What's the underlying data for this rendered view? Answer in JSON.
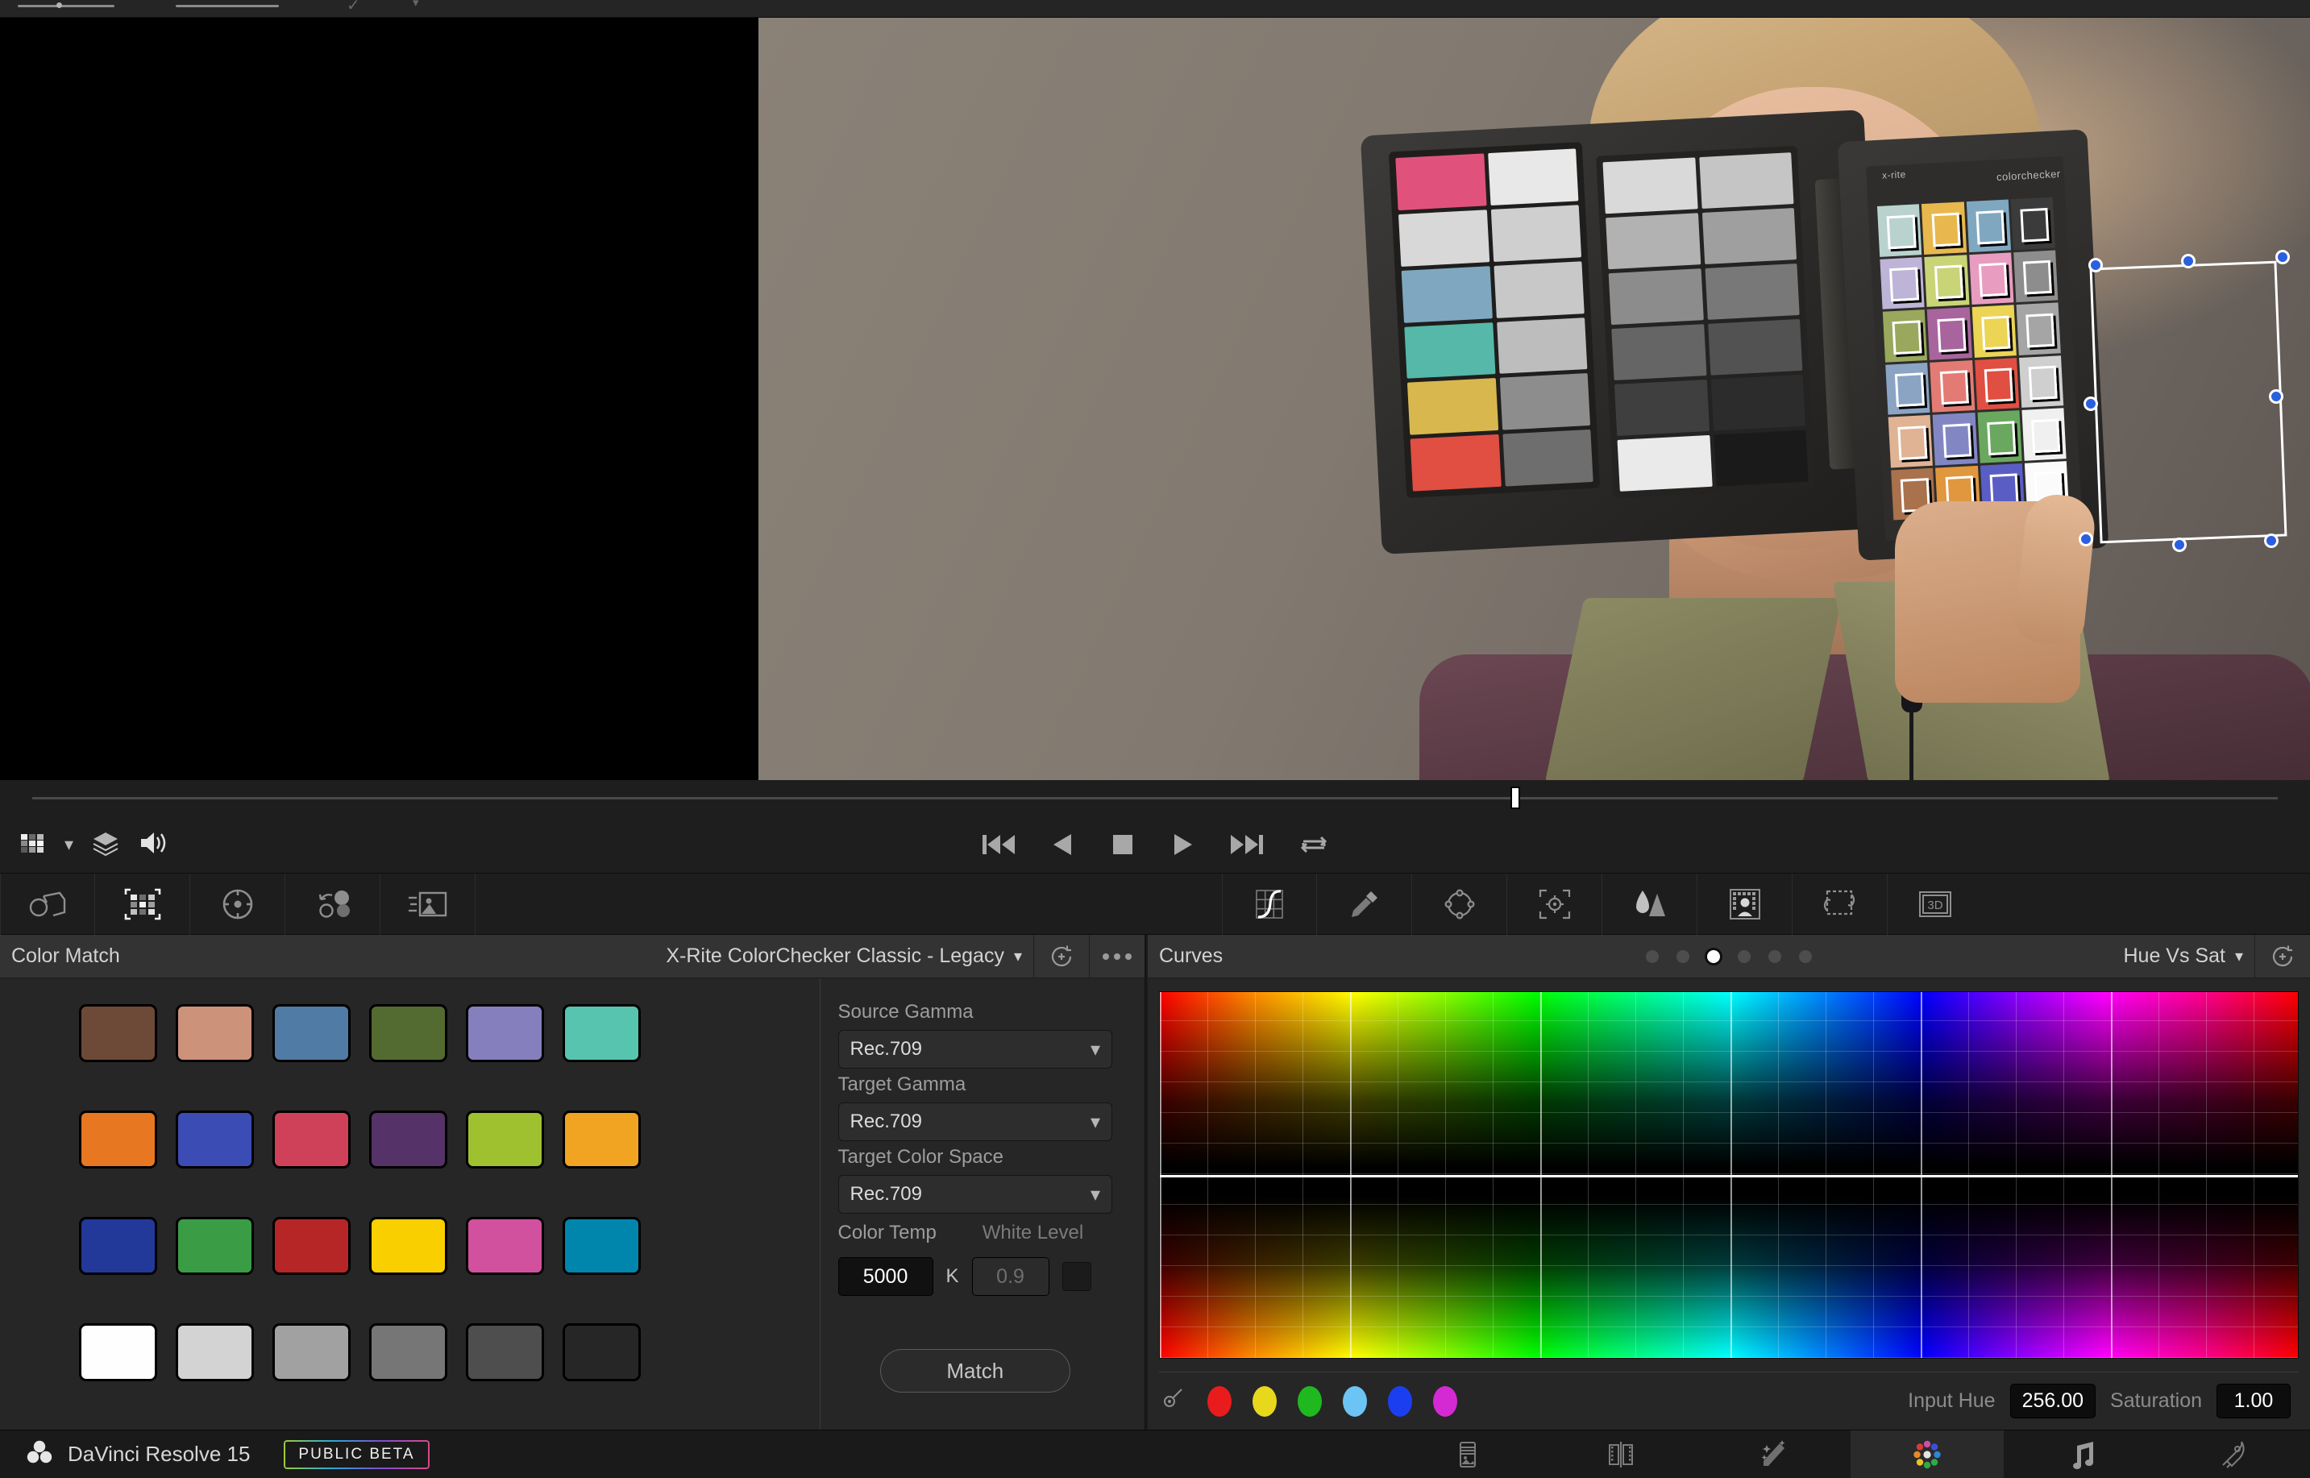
{
  "app": {
    "name": "DaVinci Resolve 15",
    "badge": "PUBLIC BETA",
    "logo_icon": "resolve-logo-icon"
  },
  "top_strip": {
    "icons": [
      "slider-control",
      "slider-control",
      "checkmark-icon",
      "chevron-icon"
    ]
  },
  "viewer": {
    "left_controls": [
      {
        "name": "viewer-mode-icon",
        "label": "grid-view-icon"
      },
      {
        "name": "viewer-mode-chevron",
        "label": "chevron-down-icon"
      },
      {
        "name": "node-layers-icon",
        "label": "layers-icon"
      },
      {
        "name": "audio-icon",
        "label": "speaker-icon"
      }
    ],
    "overlay": {
      "name": "colorchecker-overlay",
      "handles": 8,
      "sample_squares": 24
    }
  },
  "transport": {
    "buttons": [
      {
        "name": "skip-to-start-button",
        "icon": "skip-back-icon"
      },
      {
        "name": "play-reverse-button",
        "icon": "play-reverse-icon"
      },
      {
        "name": "stop-button",
        "icon": "stop-icon"
      },
      {
        "name": "play-button",
        "icon": "play-icon"
      },
      {
        "name": "skip-to-end-button",
        "icon": "skip-forward-icon"
      },
      {
        "name": "loop-button",
        "icon": "loop-icon"
      }
    ]
  },
  "toolstrip": {
    "left": [
      {
        "name": "camera-raw-button",
        "icon": "camera-raw-icon",
        "active": false
      },
      {
        "name": "color-match-button",
        "icon": "color-chart-icon",
        "active": true
      },
      {
        "name": "color-wheels-button",
        "icon": "color-wheel-icon",
        "active": false
      },
      {
        "name": "primaries-bars-button",
        "icon": "primaries-bars-icon",
        "active": false
      },
      {
        "name": "raw-image-button",
        "icon": "raw-image-icon",
        "active": false
      }
    ],
    "right": [
      {
        "name": "curves-button",
        "icon": "curves-icon",
        "active": true
      },
      {
        "name": "qualifier-button",
        "icon": "eyedropper-icon",
        "active": false
      },
      {
        "name": "power-window-button",
        "icon": "power-window-icon",
        "active": false
      },
      {
        "name": "tracker-button",
        "icon": "tracker-icon",
        "active": false
      },
      {
        "name": "blur-button",
        "icon": "blur-icon",
        "active": false
      },
      {
        "name": "key-button",
        "icon": "magic-mask-icon",
        "active": false
      },
      {
        "name": "sizing-button",
        "icon": "stabilizer-icon",
        "active": false
      },
      {
        "name": "threed-button",
        "icon": "3d-icon",
        "active": false,
        "label": "3D"
      }
    ]
  },
  "color_match": {
    "title": "Color Match",
    "chart_preset": "X-Rite ColorChecker Classic - Legacy",
    "reset_icon": "reset-icon",
    "options_icon": "more-options-icon",
    "chevron_icon": "chevron-down-icon",
    "swatches": [
      "#6d4a37",
      "#cd927a",
      "#507ba4",
      "#536b30",
      "#867fbd",
      "#57c4b0",
      "#e87722",
      "#3b4cb4",
      "#cf4159",
      "#553368",
      "#9fc130",
      "#f0a421",
      "#22399a",
      "#3a9d45",
      "#b62626",
      "#f9cf00",
      "#d2519f",
      "#0086ad",
      "#fefefe",
      "#d3d3d3",
      "#a1a1a1",
      "#767676",
      "#4e4e4e",
      "#262626"
    ],
    "settings": {
      "source_gamma_label": "Source Gamma",
      "source_gamma_value": "Rec.709",
      "target_gamma_label": "Target Gamma",
      "target_gamma_value": "Rec.709",
      "target_colorspace_label": "Target Color Space",
      "target_colorspace_value": "Rec.709",
      "color_temp_label": "Color Temp",
      "color_temp_value": "5000",
      "color_temp_unit": "K",
      "white_level_label": "White Level",
      "white_level_value": "0.9"
    },
    "match_button": "Match"
  },
  "curves": {
    "title": "Curves",
    "mode": "Hue Vs Sat",
    "chevron_icon": "chevron-down-icon",
    "reset_icon": "reset-icon",
    "page_dots": 6,
    "active_dot": 2,
    "picker_icon": "curve-picker-icon",
    "hue_dots": [
      "#e81c1c",
      "#e8d81c",
      "#1fb81f",
      "#6cc4f5",
      "#1b3ff0",
      "#d42ad4"
    ],
    "input_hue_label": "Input Hue",
    "input_hue_value": "256.00",
    "saturation_label": "Saturation",
    "saturation_value": "1.00"
  },
  "pages": [
    {
      "name": "page-media",
      "icon": "media-icon",
      "active": false
    },
    {
      "name": "page-edit",
      "icon": "edit-icon",
      "active": false
    },
    {
      "name": "page-fusion",
      "icon": "fusion-icon",
      "active": false
    },
    {
      "name": "page-color",
      "icon": "color-icon",
      "active": true
    },
    {
      "name": "page-fairlight",
      "icon": "fairlight-icon",
      "active": false
    },
    {
      "name": "page-deliver",
      "icon": "deliver-icon",
      "active": false
    }
  ],
  "chart_overlay_colors": [
    "#b9d2ce",
    "#e8b84e",
    "#7fa8c0",
    "#3b3b3b",
    "#bdb4d8",
    "#c9d477",
    "#e79cc0",
    "#8d8d8d",
    "#99a85c",
    "#a8649c",
    "#ecd455",
    "#a5a5a5",
    "#8ba4c4",
    "#e37b74",
    "#e04f42",
    "#cfcfcf",
    "#e0b394",
    "#8287c4",
    "#6aa860",
    "#f0f0f0",
    "#a9714c",
    "#e0973e",
    "#5a5ec4",
    "#fbfbfb"
  ],
  "case_panel_colors_left": [
    "#e0527c",
    "#e8e8e8",
    "#d8d8d8",
    "#cfcfcf",
    "#7fa8c0",
    "#c8c8c8",
    "#55b8a8",
    "#bdbdbd",
    "#d8b84e",
    "#8d8d8d",
    "#e04f42",
    "#6e6e6e"
  ],
  "case_panel_colors_mid": [
    "#d9d9d9",
    "#c5c5c5",
    "#b2b2b2",
    "#9f9f9f",
    "#8c8c8c",
    "#787878",
    "#656565",
    "#525252",
    "#3f3f3f",
    "#2c2c2c",
    "#eaeaea",
    "#1a1a1a"
  ]
}
